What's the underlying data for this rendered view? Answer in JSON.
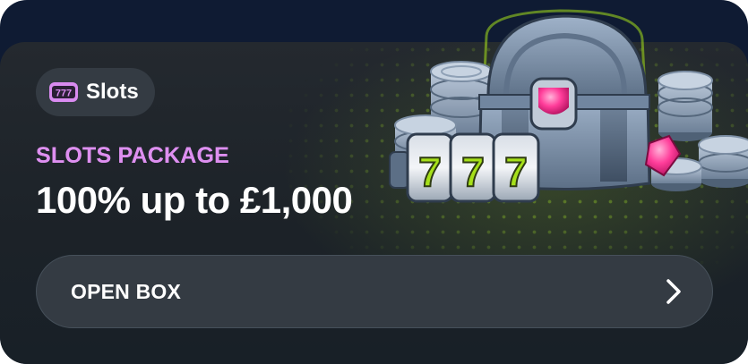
{
  "badge": {
    "icon": "slot-machine-777-icon",
    "label": "Slots"
  },
  "promo": {
    "eyebrow": "SLOTS PACKAGE",
    "headline": "100% up to £1,000"
  },
  "cta": {
    "label": "OPEN BOX",
    "icon": "chevron-right-icon"
  },
  "illustration": {
    "icon": "treasure-chest-with-coins-and-777-reels",
    "reel_symbols": [
      "7",
      "7",
      "7"
    ]
  },
  "colors": {
    "accent_pink": "#de8ff0",
    "card_background": "#1f252b",
    "button_background": "#343b43",
    "outer_background": "#0f1b33",
    "seven_green": "#a6e01a"
  }
}
